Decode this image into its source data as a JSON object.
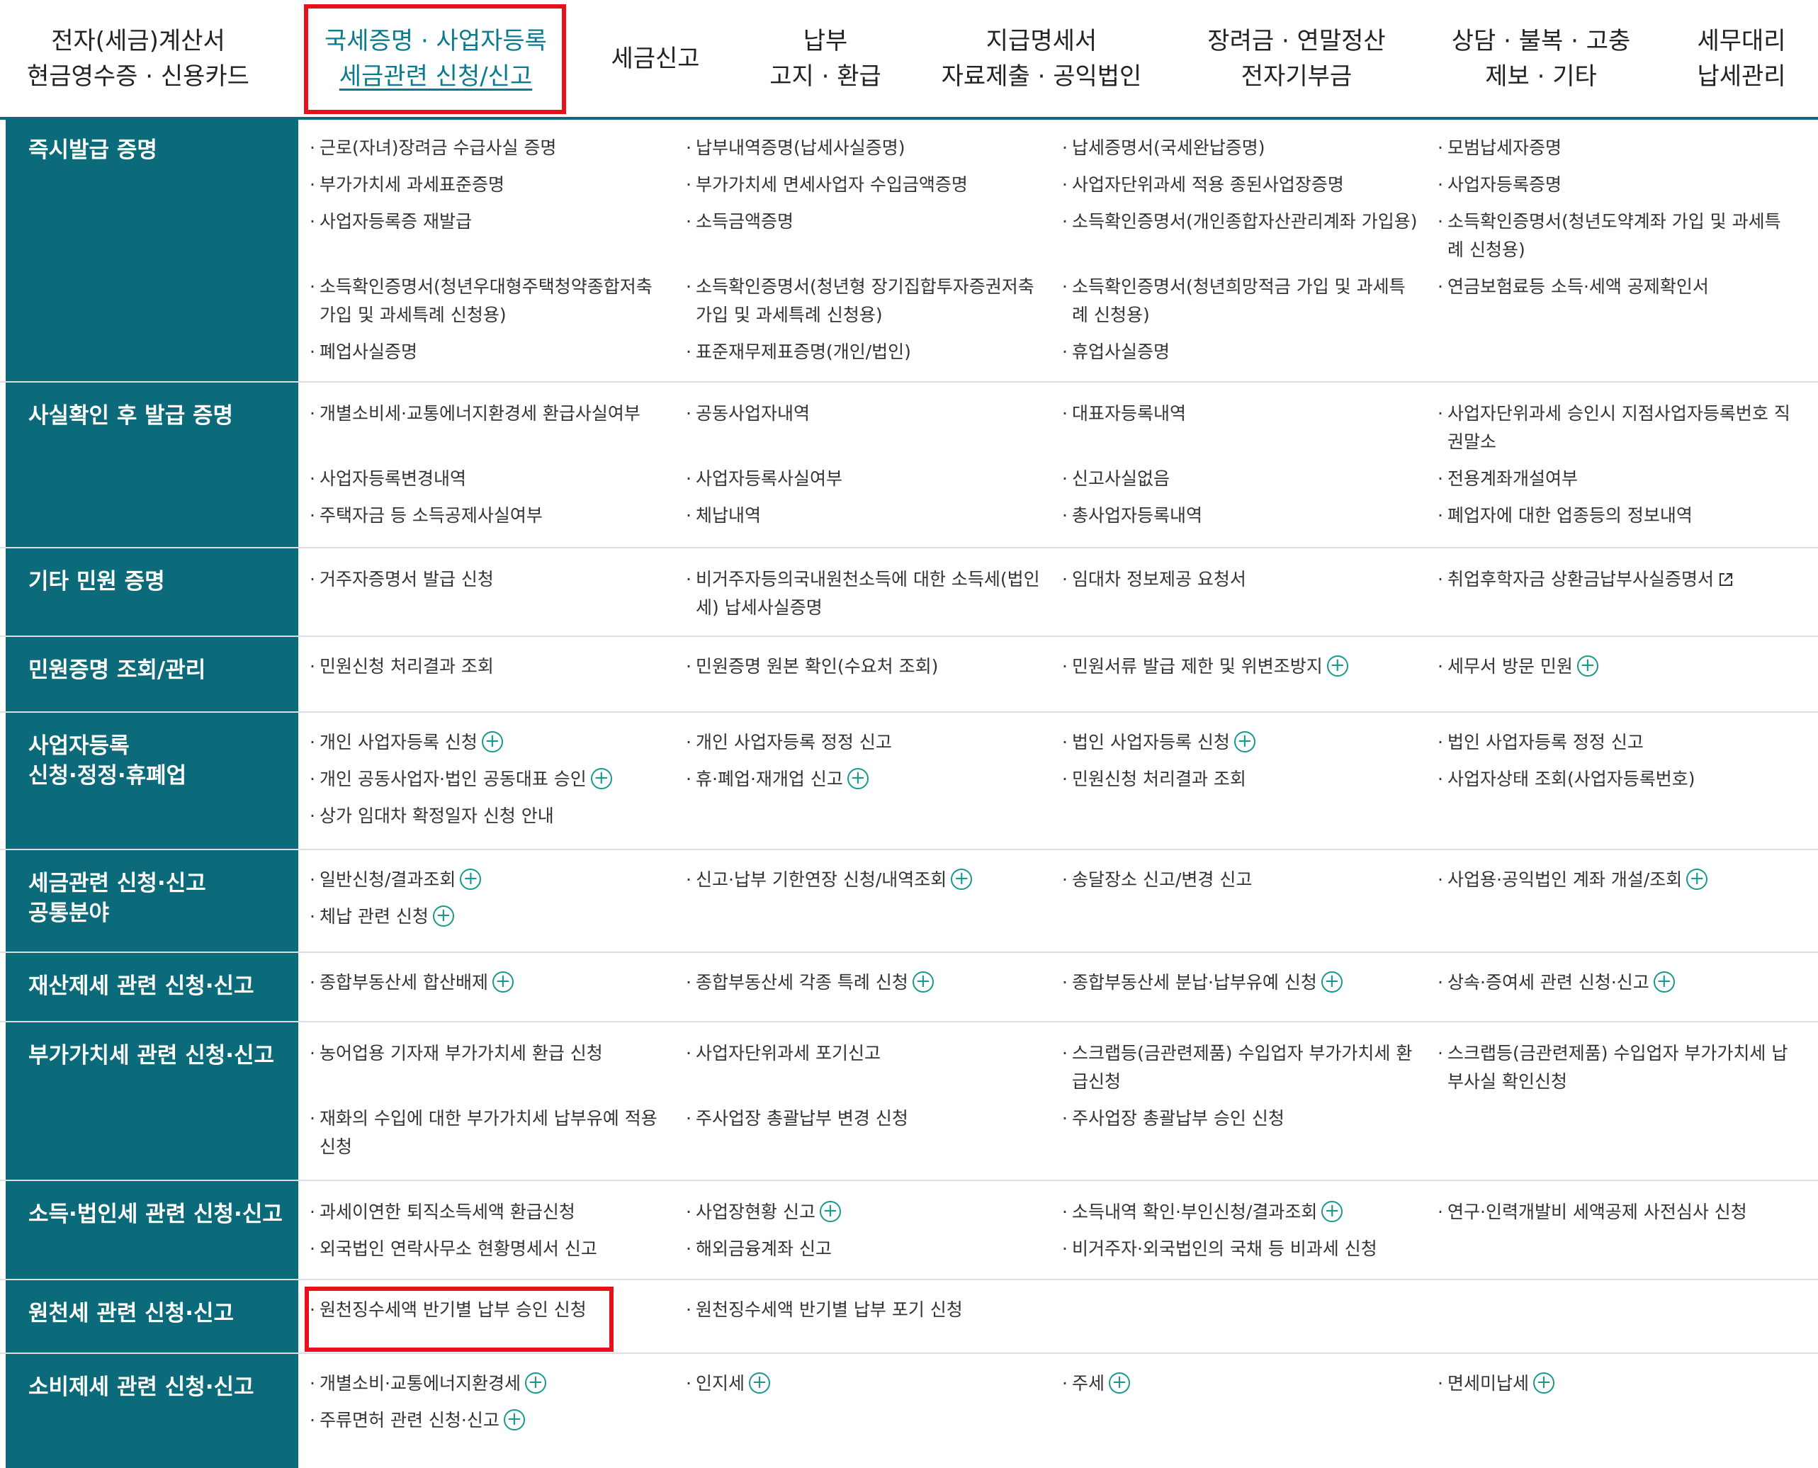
{
  "nav": {
    "items": [
      {
        "lines": [
          "전자(세금)계산서",
          "현금영수증 · 신용카드"
        ],
        "active": false
      },
      {
        "lines": [
          "국세증명 · 사업자등록",
          "세금관련 신청/신고"
        ],
        "active": true
      },
      {
        "lines": [
          "세금신고"
        ],
        "active": false
      },
      {
        "lines": [
          "납부",
          "고지 · 환급"
        ],
        "active": false
      },
      {
        "lines": [
          "지급명세서",
          "자료제출 · 공익법인"
        ],
        "active": false
      },
      {
        "lines": [
          "장려금 · 연말정산",
          "전자기부금"
        ],
        "active": false
      },
      {
        "lines": [
          "상담 · 불복 · 고충",
          "제보 · 기타"
        ],
        "active": false
      },
      {
        "lines": [
          "세무대리",
          "납세관리"
        ],
        "active": false
      }
    ]
  },
  "colors": {
    "accent": "#0c6b7a",
    "active_text": "#0a7b8c",
    "highlight": "#e8101a",
    "plus": "#18998f"
  },
  "menu": {
    "rows": [
      {
        "head": [
          "즉시발급 증명"
        ],
        "items": [
          {
            "text": "근로(자녀)장려금 수급사실 증명"
          },
          {
            "text": "납부내역증명(납세사실증명)"
          },
          {
            "text": "납세증명서(국세완납증명)"
          },
          {
            "text": "모범납세자증명"
          },
          {
            "text": "부가가치세 과세표준증명"
          },
          {
            "text": "부가가치세 면세사업자 수입금액증명"
          },
          {
            "text": "사업자단위과세 적용 종된사업장증명"
          },
          {
            "text": "사업자등록증명"
          },
          {
            "text": "사업자등록증 재발급"
          },
          {
            "text": "소득금액증명"
          },
          {
            "text": "소득확인증명서(개인종합자산관리계좌 가입용)"
          },
          {
            "text": "소득확인증명서(청년도약계좌 가입 및 과세특례 신청용)"
          },
          {
            "text": "소득확인증명서(청년우대형주택청약종합저축 가입 및 과세특례 신청용)"
          },
          {
            "text": "소득확인증명서(청년형 장기집합투자증권저축 가입 및 과세특례 신청용)"
          },
          {
            "text": "소득확인증명서(청년희망적금 가입 및 과세특례 신청용)"
          },
          {
            "text": "연금보험료등 소득·세액 공제확인서"
          },
          {
            "text": "폐업사실증명"
          },
          {
            "text": "표준재무제표증명(개인/법인)"
          },
          {
            "text": "휴업사실증명"
          }
        ]
      },
      {
        "head": [
          "사실확인 후 발급 증명"
        ],
        "items": [
          {
            "text": "개별소비세·교통에너지환경세 환급사실여부"
          },
          {
            "text": "공동사업자내역"
          },
          {
            "text": "대표자등록내역"
          },
          {
            "text": "사업자단위과세 승인시 지점사업자등록번호 직권말소"
          },
          {
            "text": "사업자등록변경내역"
          },
          {
            "text": "사업자등록사실여부"
          },
          {
            "text": "신고사실없음"
          },
          {
            "text": "전용계좌개설여부"
          },
          {
            "text": "주택자금 등 소득공제사실여부"
          },
          {
            "text": "체납내역"
          },
          {
            "text": "총사업자등록내역"
          },
          {
            "text": "폐업자에 대한 업종등의 정보내역"
          }
        ]
      },
      {
        "head": [
          "기타 민원 증명"
        ],
        "items": [
          {
            "text": "거주자증명서 발급 신청"
          },
          {
            "text": "비거주자등의국내원천소득에 대한 소득세(법인세) 납세사실증명"
          },
          {
            "text": "임대차 정보제공 요청서"
          },
          {
            "text": "취업후학자금 상환금납부사실증명서",
            "icon": "external-link-icon"
          }
        ]
      },
      {
        "head": [
          "민원증명 조회/관리"
        ],
        "items": [
          {
            "text": "민원신청 처리결과 조회"
          },
          {
            "text": "민원증명 원본 확인(수요처 조회)"
          },
          {
            "text": "민원서류 발급 제한 및 위변조방지",
            "icon": "plus-circle-icon"
          },
          {
            "text": "세무서 방문 민원",
            "icon": "plus-circle-icon"
          }
        ]
      },
      {
        "head": [
          "사업자등록",
          "신청·정정·휴폐업"
        ],
        "items": [
          {
            "text": "개인 사업자등록 신청",
            "icon": "plus-circle-icon"
          },
          {
            "text": "개인 사업자등록 정정 신고"
          },
          {
            "text": "법인 사업자등록 신청",
            "icon": "plus-circle-icon"
          },
          {
            "text": "법인 사업자등록 정정 신고"
          },
          {
            "text": "개인 공동사업자·법인 공동대표 승인",
            "icon": "plus-circle-icon"
          },
          {
            "text": "휴·폐업·재개업 신고",
            "icon": "plus-circle-icon"
          },
          {
            "text": "민원신청 처리결과 조회"
          },
          {
            "text": "사업자상태 조회(사업자등록번호)"
          },
          {
            "text": "상가 임대차 확정일자 신청 안내"
          }
        ]
      },
      {
        "head": [
          "세금관련 신청·신고",
          "공통분야"
        ],
        "items": [
          {
            "text": "일반신청/결과조회",
            "icon": "plus-circle-icon"
          },
          {
            "text": "신고·납부 기한연장 신청/내역조회",
            "icon": "plus-circle-icon"
          },
          {
            "text": "송달장소 신고/변경 신고"
          },
          {
            "text": "사업용·공익법인 계좌 개설/조회",
            "icon": "plus-circle-icon"
          },
          {
            "text": "체납 관련 신청",
            "icon": "plus-circle-icon"
          }
        ]
      },
      {
        "head": [
          "재산제세 관련 신청·신고"
        ],
        "items": [
          {
            "text": "종합부동산세 합산배제",
            "icon": "plus-circle-icon"
          },
          {
            "text": "종합부동산세 각종 특례 신청",
            "icon": "plus-circle-icon"
          },
          {
            "text": "종합부동산세 분납·납부유예 신청",
            "icon": "plus-circle-icon"
          },
          {
            "text": "상속·증여세 관련 신청·신고",
            "icon": "plus-circle-icon"
          }
        ]
      },
      {
        "head": [
          "부가가치세 관련 신청·신고"
        ],
        "items": [
          {
            "text": "농어업용 기자재 부가가치세 환급 신청"
          },
          {
            "text": "사업자단위과세 포기신고"
          },
          {
            "text": "스크랩등(금관련제품) 수입업자 부가가치세 환급신청"
          },
          {
            "text": "스크랩등(금관련제품) 수입업자 부가가치세 납부사실 확인신청"
          },
          {
            "text": "재화의 수입에 대한 부가가치세 납부유예 적용 신청"
          },
          {
            "text": "주사업장 총괄납부 변경 신청"
          },
          {
            "text": "주사업장 총괄납부 승인 신청"
          }
        ]
      },
      {
        "head": [
          "소득·법인세 관련 신청·신고"
        ],
        "items": [
          {
            "text": "과세이연한 퇴직소득세액 환급신청"
          },
          {
            "text": "사업장현황 신고",
            "icon": "plus-circle-icon"
          },
          {
            "text": "소득내역 확인·부인신청/결과조회",
            "icon": "plus-circle-icon"
          },
          {
            "text": "연구·인력개발비 세액공제 사전심사 신청"
          },
          {
            "text": "외국법인 연락사무소 현황명세서 신고"
          },
          {
            "text": "해외금융계좌 신고"
          },
          {
            "text": "비거주자·외국법인의 국채 등 비과세 신청"
          }
        ]
      },
      {
        "head": [
          "원천세 관련 신청·신고"
        ],
        "items": [
          {
            "text": "원천징수세액 반기별 납부 승인 신청"
          },
          {
            "text": "원천징수세액 반기별 납부 포기 신청"
          }
        ]
      },
      {
        "head": [
          "소비제세 관련 신청·신고"
        ],
        "items": [
          {
            "text": "개별소비·교통에너지환경세",
            "icon": "plus-circle-icon"
          },
          {
            "text": "인지세",
            "icon": "plus-circle-icon"
          },
          {
            "text": "주세",
            "icon": "plus-circle-icon"
          },
          {
            "text": "면세미납세",
            "icon": "plus-circle-icon"
          },
          {
            "text": "주류면허 관련 신청·신고",
            "icon": "plus-circle-icon"
          }
        ]
      }
    ]
  }
}
